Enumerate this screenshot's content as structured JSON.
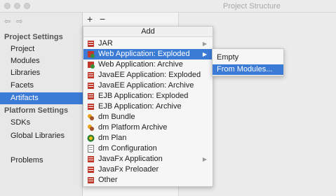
{
  "window": {
    "title": "Project Structure"
  },
  "nav": {
    "back": "⇦",
    "forward": "⇨"
  },
  "sidebar": {
    "project_settings_header": "Project Settings",
    "project_settings": [
      "Project",
      "Modules",
      "Libraries",
      "Facets",
      "Artifacts"
    ],
    "platform_settings_header": "Platform Settings",
    "platform_settings": [
      "SDKs",
      "Global Libraries"
    ],
    "problems": "Problems",
    "selected": "Artifacts"
  },
  "toolbar": {
    "add": "+",
    "remove": "−"
  },
  "menu": {
    "header": "Add",
    "items": [
      {
        "label": "JAR",
        "icon": "jar-icon",
        "submenu": true
      },
      {
        "label": "Web Application: Exploded",
        "icon": "web-app-icon",
        "submenu": true,
        "active": true
      },
      {
        "label": "Web Application: Archive",
        "icon": "web-archive-icon"
      },
      {
        "label": "JavaEE Application: Exploded",
        "icon": "javaee-icon"
      },
      {
        "label": "JavaEE Application: Archive",
        "icon": "javaee-archive-icon"
      },
      {
        "label": "EJB Application: Exploded",
        "icon": "ejb-icon"
      },
      {
        "label": "EJB Application: Archive",
        "icon": "ejb-archive-icon"
      },
      {
        "label": "dm Bundle",
        "icon": "dm-bundle-icon"
      },
      {
        "label": "dm Platform Archive",
        "icon": "dm-platform-icon"
      },
      {
        "label": "dm Plan",
        "icon": "dm-plan-icon"
      },
      {
        "label": "dm Configuration",
        "icon": "dm-config-icon"
      },
      {
        "label": "JavaFx Application",
        "icon": "javafx-icon",
        "submenu": true
      },
      {
        "label": "JavaFx Preloader",
        "icon": "javafx-preloader-icon"
      },
      {
        "label": "Other",
        "icon": "other-icon"
      }
    ]
  },
  "submenu": {
    "items": [
      {
        "label": "Empty"
      },
      {
        "label": "From Modules...",
        "active": true
      }
    ]
  },
  "colors": {
    "selection": "#3b7bd6",
    "jar_icon": "#c0392b"
  }
}
